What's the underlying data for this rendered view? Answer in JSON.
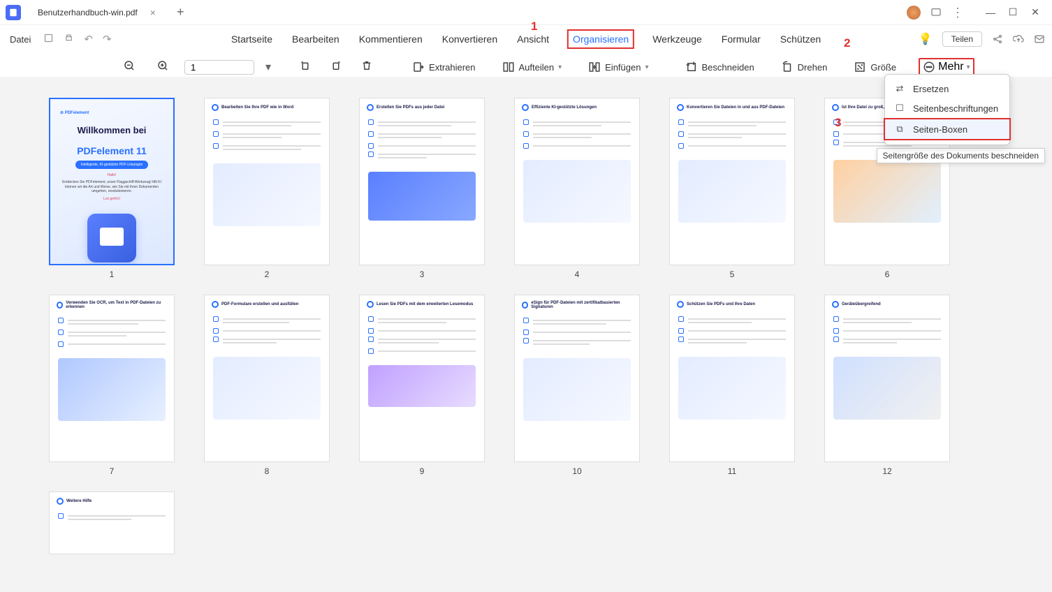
{
  "titlebar": {
    "filename": "Benutzerhandbuch-win.pdf"
  },
  "menubar": {
    "file": "Datei",
    "items": [
      "Startseite",
      "Bearbeiten",
      "Kommentieren",
      "Konvertieren",
      "Ansicht",
      "Organisieren",
      "Werkzeuge",
      "Formular",
      "Schützen"
    ],
    "active_index": 5,
    "share": "Teilen"
  },
  "toolbar": {
    "page_value": "1",
    "extract": "Extrahieren",
    "split": "Aufteilen",
    "insert": "Einfügen",
    "crop": "Beschneiden",
    "rotate": "Drehen",
    "size": "Größe",
    "more": "Mehr"
  },
  "dropdown": {
    "replace": "Ersetzen",
    "labels": "Seitenbeschriftungen",
    "boxes": "Seiten-Boxen",
    "tooltip": "Seitengröße des Dokuments beschneiden"
  },
  "annotations": {
    "a1": "1",
    "a2": "2",
    "a3": "3"
  },
  "pages": {
    "p1": {
      "logo": "⊘ PDFelement",
      "title_line1": "Willkommen bei",
      "title_line2": "PDFelement 11",
      "badge": "Intelligente, KI-gestützte PDF-Lösungen",
      "red": "Hallo!",
      "sub": "Entdecken Sie PDFelement, unser Flaggschiff-Werkzeug! Mit KI können wir die Art und Weise, wie Sie mit ihren Dokumenten umgehen, revolutionieren.",
      "cta": "Los geht's!"
    },
    "p2": {
      "title": "Bearbeiten Sie Ihre PDF wie in Word"
    },
    "p3": {
      "title": "Erstellen Sie PDFs aus jeder Datei"
    },
    "p4": {
      "title": "Effiziente KI-gestützte Lösungen"
    },
    "p5": {
      "title": "Konvertieren Sie Dateien in und aus PDF-Dateien"
    },
    "p6": {
      "title": "Ist Ihre Datei zu groß, um sie freizugeben?"
    },
    "p7": {
      "title": "Verwenden Sie OCR, um Text in PDF-Dateien zu erkennen"
    },
    "p8": {
      "title": "PDF-Formulare erstellen und ausfüllen"
    },
    "p9": {
      "title": "Lesen Sie PDFs mit dem erweiterten Lesemodus"
    },
    "p10": {
      "title": "eSign für PDF-Dateien mit zertifikatbasierten Signaturen"
    },
    "p11": {
      "title": "Schützen Sie PDFs und Ihre Daten"
    },
    "p12": {
      "title": "Geräteübergreifend"
    },
    "p13": {
      "title": "Weitere Hilfe"
    }
  },
  "numbers": [
    "1",
    "2",
    "3",
    "4",
    "5",
    "6",
    "7",
    "8",
    "9",
    "10",
    "11",
    "12"
  ]
}
